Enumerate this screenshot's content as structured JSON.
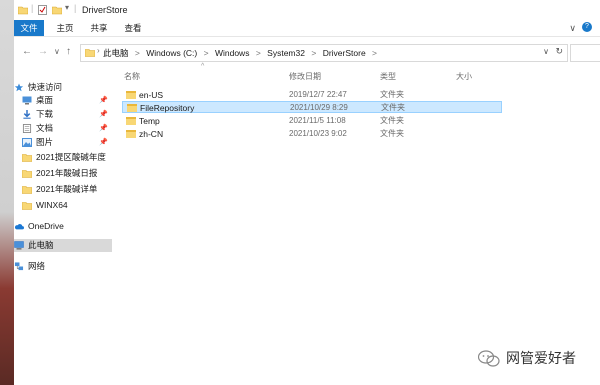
{
  "window": {
    "title": "DriverStore"
  },
  "ribbon": {
    "tabs": [
      {
        "label": "文件",
        "active": true
      },
      {
        "label": "主页"
      },
      {
        "label": "共享"
      },
      {
        "label": "查看"
      }
    ]
  },
  "address": {
    "crumbs": [
      "此电脑",
      ">",
      "Windows (C:)",
      ">",
      "Windows",
      ">",
      "System32",
      ">",
      "DriverStore",
      ">"
    ]
  },
  "nav": {
    "items": [
      {
        "label": "快速访问",
        "icon": "star-icon",
        "pinned": false
      },
      {
        "label": "桌面",
        "icon": "desktop-icon",
        "pinned": true
      },
      {
        "label": "下载",
        "icon": "download-icon",
        "pinned": true
      },
      {
        "label": "文档",
        "icon": "document-icon",
        "pinned": true
      },
      {
        "label": "图片",
        "icon": "picture-icon",
        "pinned": true
      },
      {
        "label": "2021提区酸碱年度",
        "icon": "folder-icon",
        "pinned": false
      },
      {
        "label": "2021年酸碱日报",
        "icon": "folder-icon",
        "pinned": false
      },
      {
        "label": "2021年酸碱详单",
        "icon": "folder-icon",
        "pinned": false
      },
      {
        "label": "WINX64",
        "icon": "folder-icon",
        "pinned": false
      },
      {
        "label": "OneDrive",
        "icon": "cloud-icon",
        "pinned": false
      },
      {
        "label": "此电脑",
        "icon": "computer-icon",
        "pinned": false,
        "selected": true
      },
      {
        "label": "网络",
        "icon": "network-icon",
        "pinned": false
      }
    ]
  },
  "columns": {
    "name": "名称",
    "date": "修改日期",
    "type": "类型",
    "size": "大小"
  },
  "files": [
    {
      "name": "en-US",
      "date": "2019/12/7 22:47",
      "type": "文件夹"
    },
    {
      "name": "FileRepository",
      "date": "2021/10/29 8:29",
      "type": "文件夹",
      "selected": true
    },
    {
      "name": "Temp",
      "date": "2021/11/5 11:08",
      "type": "文件夹"
    },
    {
      "name": "zh-CN",
      "date": "2021/10/23 9:02",
      "type": "文件夹"
    }
  ],
  "watermark": {
    "text": "网管爱好者"
  },
  "colors": {
    "accent": "#1979ca",
    "selection": "#cce8ff",
    "folder": "#f8d775"
  }
}
